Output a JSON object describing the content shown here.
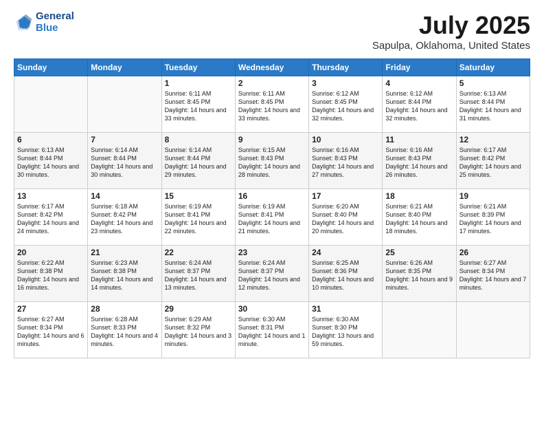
{
  "header": {
    "logo_line1": "General",
    "logo_line2": "Blue",
    "title": "July 2025",
    "subtitle": "Sapulpa, Oklahoma, United States"
  },
  "weekdays": [
    "Sunday",
    "Monday",
    "Tuesday",
    "Wednesday",
    "Thursday",
    "Friday",
    "Saturday"
  ],
  "weeks": [
    [
      {
        "day": "",
        "text": ""
      },
      {
        "day": "",
        "text": ""
      },
      {
        "day": "1",
        "text": "Sunrise: 6:11 AM\nSunset: 8:45 PM\nDaylight: 14 hours and 33 minutes."
      },
      {
        "day": "2",
        "text": "Sunrise: 6:11 AM\nSunset: 8:45 PM\nDaylight: 14 hours and 33 minutes."
      },
      {
        "day": "3",
        "text": "Sunrise: 6:12 AM\nSunset: 8:45 PM\nDaylight: 14 hours and 32 minutes."
      },
      {
        "day": "4",
        "text": "Sunrise: 6:12 AM\nSunset: 8:44 PM\nDaylight: 14 hours and 32 minutes."
      },
      {
        "day": "5",
        "text": "Sunrise: 6:13 AM\nSunset: 8:44 PM\nDaylight: 14 hours and 31 minutes."
      }
    ],
    [
      {
        "day": "6",
        "text": "Sunrise: 6:13 AM\nSunset: 8:44 PM\nDaylight: 14 hours and 30 minutes."
      },
      {
        "day": "7",
        "text": "Sunrise: 6:14 AM\nSunset: 8:44 PM\nDaylight: 14 hours and 30 minutes."
      },
      {
        "day": "8",
        "text": "Sunrise: 6:14 AM\nSunset: 8:44 PM\nDaylight: 14 hours and 29 minutes."
      },
      {
        "day": "9",
        "text": "Sunrise: 6:15 AM\nSunset: 8:43 PM\nDaylight: 14 hours and 28 minutes."
      },
      {
        "day": "10",
        "text": "Sunrise: 6:16 AM\nSunset: 8:43 PM\nDaylight: 14 hours and 27 minutes."
      },
      {
        "day": "11",
        "text": "Sunrise: 6:16 AM\nSunset: 8:43 PM\nDaylight: 14 hours and 26 minutes."
      },
      {
        "day": "12",
        "text": "Sunrise: 6:17 AM\nSunset: 8:42 PM\nDaylight: 14 hours and 25 minutes."
      }
    ],
    [
      {
        "day": "13",
        "text": "Sunrise: 6:17 AM\nSunset: 8:42 PM\nDaylight: 14 hours and 24 minutes."
      },
      {
        "day": "14",
        "text": "Sunrise: 6:18 AM\nSunset: 8:42 PM\nDaylight: 14 hours and 23 minutes."
      },
      {
        "day": "15",
        "text": "Sunrise: 6:19 AM\nSunset: 8:41 PM\nDaylight: 14 hours and 22 minutes."
      },
      {
        "day": "16",
        "text": "Sunrise: 6:19 AM\nSunset: 8:41 PM\nDaylight: 14 hours and 21 minutes."
      },
      {
        "day": "17",
        "text": "Sunrise: 6:20 AM\nSunset: 8:40 PM\nDaylight: 14 hours and 20 minutes."
      },
      {
        "day": "18",
        "text": "Sunrise: 6:21 AM\nSunset: 8:40 PM\nDaylight: 14 hours and 18 minutes."
      },
      {
        "day": "19",
        "text": "Sunrise: 6:21 AM\nSunset: 8:39 PM\nDaylight: 14 hours and 17 minutes."
      }
    ],
    [
      {
        "day": "20",
        "text": "Sunrise: 6:22 AM\nSunset: 8:38 PM\nDaylight: 14 hours and 16 minutes."
      },
      {
        "day": "21",
        "text": "Sunrise: 6:23 AM\nSunset: 8:38 PM\nDaylight: 14 hours and 14 minutes."
      },
      {
        "day": "22",
        "text": "Sunrise: 6:24 AM\nSunset: 8:37 PM\nDaylight: 14 hours and 13 minutes."
      },
      {
        "day": "23",
        "text": "Sunrise: 6:24 AM\nSunset: 8:37 PM\nDaylight: 14 hours and 12 minutes."
      },
      {
        "day": "24",
        "text": "Sunrise: 6:25 AM\nSunset: 8:36 PM\nDaylight: 14 hours and 10 minutes."
      },
      {
        "day": "25",
        "text": "Sunrise: 6:26 AM\nSunset: 8:35 PM\nDaylight: 14 hours and 9 minutes."
      },
      {
        "day": "26",
        "text": "Sunrise: 6:27 AM\nSunset: 8:34 PM\nDaylight: 14 hours and 7 minutes."
      }
    ],
    [
      {
        "day": "27",
        "text": "Sunrise: 6:27 AM\nSunset: 8:34 PM\nDaylight: 14 hours and 6 minutes."
      },
      {
        "day": "28",
        "text": "Sunrise: 6:28 AM\nSunset: 8:33 PM\nDaylight: 14 hours and 4 minutes."
      },
      {
        "day": "29",
        "text": "Sunrise: 6:29 AM\nSunset: 8:32 PM\nDaylight: 14 hours and 3 minutes."
      },
      {
        "day": "30",
        "text": "Sunrise: 6:30 AM\nSunset: 8:31 PM\nDaylight: 14 hours and 1 minute."
      },
      {
        "day": "31",
        "text": "Sunrise: 6:30 AM\nSunset: 8:30 PM\nDaylight: 13 hours and 59 minutes."
      },
      {
        "day": "",
        "text": ""
      },
      {
        "day": "",
        "text": ""
      }
    ]
  ]
}
